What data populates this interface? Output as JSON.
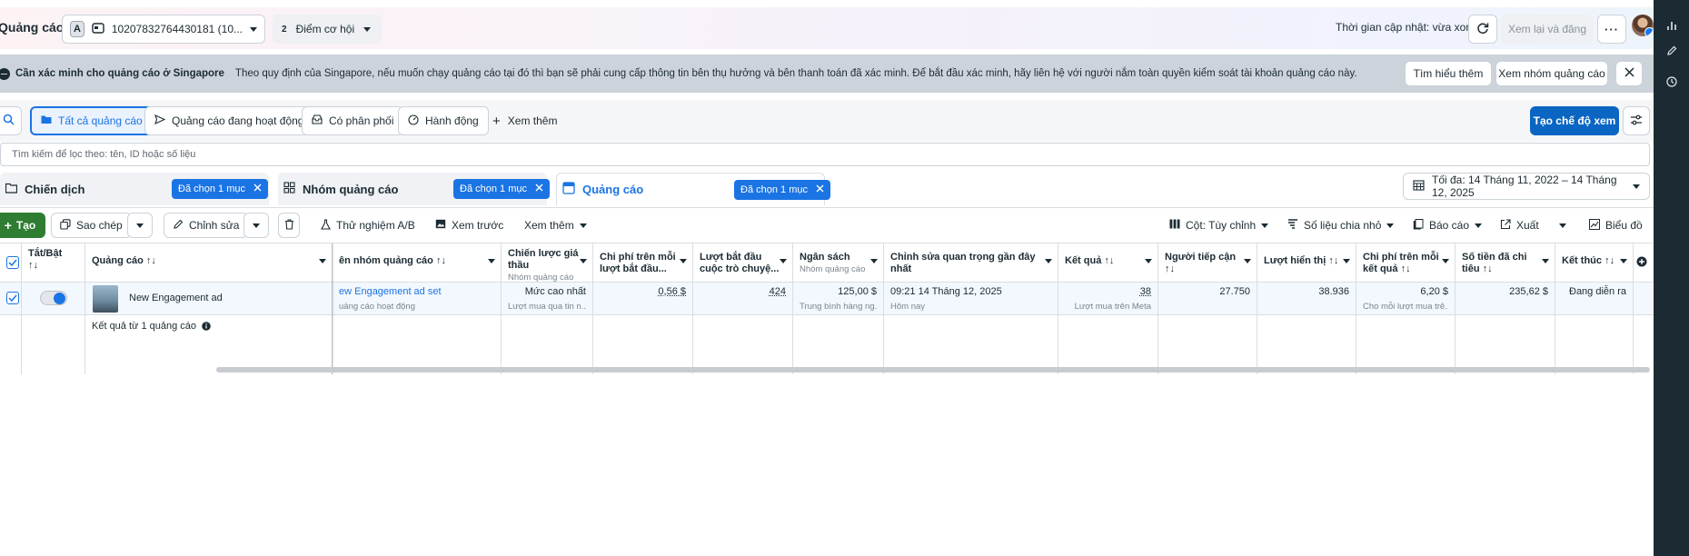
{
  "header": {
    "title": "Quảng cáo",
    "account_badge": "A",
    "account_label": "10207832764430181 (10...",
    "opportunity_count": "2",
    "opportunity_label": "Điểm cơ hội",
    "updated_text": "Thời gian cập nhật: vừa xong",
    "review_publish": "Xem lại và đăng"
  },
  "banner": {
    "title": "Cần xác minh cho quảng cáo ở Singapore",
    "message": "Theo quy định của Singapore, nếu muốn chạy quảng cáo tại đó thì bạn sẽ phải cung cấp thông tin bên thụ hưởng và bên thanh toán đã xác minh. Để bắt đầu xác minh, hãy liên hệ với người nắm toàn quyền kiểm soát tài khoản quảng cáo này.",
    "learn_more": "Tìm hiểu thêm",
    "view_adset": "Xem nhóm quảng cáo"
  },
  "filters": {
    "chips": [
      "Tất cả quảng cáo",
      "Quảng cáo đang hoạt động",
      "Có phân phối",
      "Hành động"
    ],
    "more": "Xem thêm",
    "create_view": "Tạo chế độ xem",
    "search_placeholder": "Tìm kiếm để lọc theo: tên, ID hoặc số liệu"
  },
  "levels": {
    "campaign": "Chiến dịch",
    "adset": "Nhóm quảng cáo",
    "ad": "Quảng cáo",
    "selected": "Đã chọn 1 mục",
    "date_range": "Tối đa: 14 Tháng 11, 2022 – 14 Tháng 12, 2025"
  },
  "toolbar": {
    "create": "Tạo",
    "duplicate": "Sao chép",
    "edit": "Chỉnh sửa",
    "ab_test": "Thử nghiệm A/B",
    "preview": "Xem trước",
    "more": "Xem thêm",
    "columns": "Cột: Tùy chỉnh",
    "breakdown": "Số liệu chia nhỏ",
    "reports": "Báo cáo",
    "export": "Xuất",
    "chart": "Biểu đồ"
  },
  "table": {
    "headers": {
      "toggle": "Tắt/Bật",
      "ad": "Quảng cáo",
      "adset": "ên nhóm quảng cáo",
      "bid_line1": "Chiến lược giá",
      "bid_line2": "thầu",
      "bid_sub": "Nhóm quảng cáo",
      "cost_start_line1": "Chi phí trên mỗi",
      "cost_start_line2": "lượt bắt đầu...",
      "conv_start_line1": "Lượt bắt đầu",
      "conv_start_line2": "cuộc trò chuyệ...",
      "budget": "Ngân sách",
      "budget_sub": "Nhóm quảng cáo",
      "last_edit_line1": "Chỉnh sửa quan trọng gần đây",
      "last_edit_line2": "nhất",
      "results": "Kết quả",
      "reach": "Người tiếp cận",
      "impressions": "Lượt hiển thị",
      "cpr_line1": "Chi phí trên mỗi",
      "cpr_line2": "kết quả",
      "spent_line1": "Số tiền đã chi",
      "spent_line2": "tiêu",
      "ends": "Kết thúc"
    },
    "row": {
      "ad_name": "New Engagement ad",
      "adset_name": "ew Engagement ad set",
      "adset_sub": "uảng cáo hoạt động",
      "bid": "Mức cao nhất",
      "bid_sub": "Lượt mua qua tin n...",
      "cost_start": "0,56 $",
      "conv_start": "424",
      "budget": "125,00 $",
      "budget_sub": "Trung bình hàng ng...",
      "last_edit": "09:21 14 Tháng 12, 2025",
      "last_edit_sub": "Hôm nay",
      "results": "38",
      "results_sub": "Lượt mua trên Meta",
      "reach": "27.750",
      "impressions": "38.936",
      "cpr": "6,20 $",
      "cpr_sub": "Cho mỗi lượt mua trê...",
      "spent": "235,62 $",
      "ends": "Đang diễn ra"
    },
    "footer": "Kết quả từ 1 quảng cáo"
  },
  "colors": {
    "primary": "#1b74e4",
    "create_green": "#2e7d32",
    "banner_bg": "#cdd3da"
  }
}
